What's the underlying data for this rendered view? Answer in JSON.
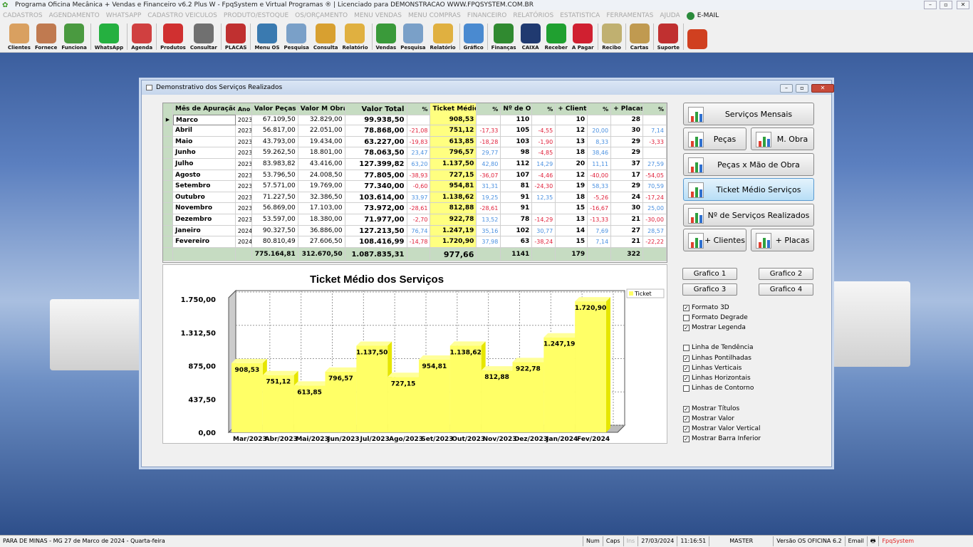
{
  "app": {
    "title": "Programa Oficina Mecânica + Vendas e Financeiro v6.2 Plus W - FpqSystem e Virtual Programas ® | Licenciado para  DEMONSTRACAO WWW.FPQSYSTEM.COM.BR"
  },
  "menu": [
    "CADASTROS",
    "AGENDAMENTO",
    "WHATSAPP",
    "CADASTRO VEICULOS",
    "PRODUTO/ESTOQUE",
    "OS/ORÇAMENTO",
    "MENU VENDAS",
    "MENU COMPRAS",
    "FINANCEIRO",
    "RELATÓRIOS",
    "ESTATISTICA",
    "FERRAMENTAS",
    "AJUDA"
  ],
  "menu_email": "E-MAIL",
  "toolbar": [
    {
      "label": "Clientes",
      "color": "#d9a060"
    },
    {
      "label": "Fornece",
      "color": "#c07a50"
    },
    {
      "label": "Funciona",
      "color": "#4a9a40"
    },
    "|",
    {
      "label": "WhatsApp",
      "color": "#25b040"
    },
    "|",
    {
      "label": "Agenda",
      "color": "#d04040"
    },
    "|",
    {
      "label": "Produtos",
      "color": "#d03030"
    },
    {
      "label": "Consultar",
      "color": "#707070"
    },
    "|",
    {
      "label": "PLACAS",
      "color": "#c03030"
    },
    "|",
    {
      "label": "Menu OS",
      "color": "#3a7ab0"
    },
    {
      "label": "Pesquisa",
      "color": "#7aa0c8"
    },
    {
      "label": "Consulta",
      "color": "#d8a030"
    },
    {
      "label": "Relatório",
      "color": "#e0b040"
    },
    "|",
    {
      "label": "Vendas",
      "color": "#3a9a3a"
    },
    {
      "label": "Pesquisa",
      "color": "#7aa0c8"
    },
    {
      "label": "Relatório",
      "color": "#e0b040"
    },
    "|",
    {
      "label": "Gráfico",
      "color": "#4a8ad0"
    },
    "|",
    {
      "label": "Finanças",
      "color": "#308a30"
    },
    {
      "label": "CAIXA",
      "color": "#203a70"
    },
    {
      "label": "Receber",
      "color": "#20a030"
    },
    {
      "label": "A Pagar",
      "color": "#d02030"
    },
    "|",
    {
      "label": "Recibo",
      "color": "#c0b070"
    },
    "|",
    {
      "label": "Cartas",
      "color": "#c09a50"
    },
    "|",
    {
      "label": "Suporte",
      "color": "#c03030"
    },
    "|",
    {
      "label": "",
      "color": "#d04020"
    }
  ],
  "dialog": {
    "title": "Demonstrativo dos Serviços Realizados"
  },
  "table": {
    "headers": [
      "Mês de Apuração",
      "Ano",
      "Valor Peças",
      "Valor M Obra",
      "Valor Total",
      "%",
      "Ticket Médio",
      "%",
      "Nº de OS",
      "%",
      "+ Clientes",
      "%",
      "+ Placas",
      "%"
    ],
    "rows": [
      [
        "Marco",
        "2023",
        "67.109,50",
        "32.829,00",
        "99.938,50",
        "",
        "908,53",
        "",
        "110",
        "",
        "10",
        "",
        "28",
        ""
      ],
      [
        "Abril",
        "2023",
        "56.817,00",
        "22.051,00",
        "78.868,00",
        "-21,08",
        "751,12",
        "-17,33",
        "105",
        "-4,55",
        "12",
        "20,00",
        "30",
        "7,14"
      ],
      [
        "Maio",
        "2023",
        "43.793,00",
        "19.434,00",
        "63.227,00",
        "-19,83",
        "613,85",
        "-18,28",
        "103",
        "-1,90",
        "13",
        "8,33",
        "29",
        "-3,33"
      ],
      [
        "Junho",
        "2023",
        "59.262,50",
        "18.801,00",
        "78.063,50",
        "23,47",
        "796,57",
        "29,77",
        "98",
        "-4,85",
        "18",
        "38,46",
        "29",
        ""
      ],
      [
        "Julho",
        "2023",
        "83.983,82",
        "43.416,00",
        "127.399,82",
        "63,20",
        "1.137,50",
        "42,80",
        "112",
        "14,29",
        "20",
        "11,11",
        "37",
        "27,59"
      ],
      [
        "Agosto",
        "2023",
        "53.796,50",
        "24.008,50",
        "77.805,00",
        "-38,93",
        "727,15",
        "-36,07",
        "107",
        "-4,46",
        "12",
        "-40,00",
        "17",
        "-54,05"
      ],
      [
        "Setembro",
        "2023",
        "57.571,00",
        "19.769,00",
        "77.340,00",
        "-0,60",
        "954,81",
        "31,31",
        "81",
        "-24,30",
        "19",
        "58,33",
        "29",
        "70,59"
      ],
      [
        "Outubro",
        "2023",
        "71.227,50",
        "32.386,50",
        "103.614,00",
        "33,97",
        "1.138,62",
        "19,25",
        "91",
        "12,35",
        "18",
        "-5,26",
        "24",
        "-17,24"
      ],
      [
        "Novembro",
        "2023",
        "56.869,00",
        "17.103,00",
        "73.972,00",
        "-28,61",
        "812,88",
        "-28,61",
        "91",
        "",
        "15",
        "-16,67",
        "30",
        "25,00"
      ],
      [
        "Dezembro",
        "2023",
        "53.597,00",
        "18.380,00",
        "71.977,00",
        "-2,70",
        "922,78",
        "13,52",
        "78",
        "-14,29",
        "13",
        "-13,33",
        "21",
        "-30,00"
      ],
      [
        "Janeiro",
        "2024",
        "90.327,50",
        "36.886,00",
        "127.213,50",
        "76,74",
        "1.247,19",
        "35,16",
        "102",
        "30,77",
        "14",
        "7,69",
        "27",
        "28,57"
      ],
      [
        "Fevereiro",
        "2024",
        "80.810,49",
        "27.606,50",
        "108.416,99",
        "-14,78",
        "1.720,90",
        "37,98",
        "63",
        "-38,24",
        "15",
        "7,14",
        "21",
        "-22,22"
      ]
    ],
    "totals": [
      "",
      "",
      "775.164,81",
      "312.670,50",
      "1.087.835,31",
      "",
      "977,66",
      "",
      "1141",
      "",
      "179",
      "",
      "322",
      ""
    ]
  },
  "chart_data": {
    "type": "bar",
    "title": "Ticket Médio dos Serviços",
    "categories": [
      "Mar/2023",
      "Abr/2023",
      "Mai/2023",
      "Jun/2023",
      "Jul/2023",
      "Ago/2023",
      "Set/2023",
      "Out/2023",
      "Nov/2023",
      "Dez/2023",
      "Jan/2024",
      "Fev/2024"
    ],
    "series": [
      {
        "name": "Ticket",
        "values": [
          908.53,
          751.12,
          613.85,
          796.57,
          1137.5,
          727.15,
          954.81,
          1138.62,
          812.88,
          922.78,
          1247.19,
          1720.9
        ]
      }
    ],
    "value_labels": [
      "908,53",
      "751,12",
      "613,85",
      "796,57",
      "1.137,50",
      "727,15",
      "954,81",
      "1.138,62",
      "812,88",
      "922,78",
      "1.247,19",
      "1.720,90"
    ],
    "yticks": [
      0,
      437.5,
      875,
      1312.5,
      1750
    ],
    "ytick_labels": [
      "0,00",
      "437,50",
      "875,00",
      "1.312,50",
      "1.750,00"
    ],
    "ylim": [
      0,
      1750
    ],
    "style": "3d",
    "grid": "dotted vertical and horizontal",
    "legend": "top-right",
    "bar_color": "#ffff66"
  },
  "right_panel": {
    "buttons": [
      "Serviços Mensais",
      "Peças",
      "M. Obra",
      "Peças x Mão de Obra",
      "Ticket Médio Serviços",
      "Nº de Serviços Realizados",
      "+ Clientes",
      "+ Placas"
    ],
    "active": "Ticket Médio Serviços",
    "graph_buttons": [
      "Grafico 1",
      "Grafico 2",
      "Grafico 3",
      "Grafico 4"
    ],
    "options": [
      {
        "label": "Formato 3D",
        "checked": true
      },
      {
        "label": "Formato Degrade",
        "checked": false
      },
      {
        "label": "Mostrar Legenda",
        "checked": true
      },
      {
        "label": "Linha de Tendência",
        "checked": false
      },
      {
        "label": "Linhas Pontilhadas",
        "checked": true
      },
      {
        "label": "Linhas Verticais",
        "checked": true
      },
      {
        "label": "Linhas Horizontais",
        "checked": true
      },
      {
        "label": "Linhas de Contorno",
        "checked": false
      },
      {
        "label": "Mostrar Títulos",
        "checked": true
      },
      {
        "label": "Mostrar Valor",
        "checked": true
      },
      {
        "label": "Mostrar Valor Vertical",
        "checked": true
      },
      {
        "label": "Mostrar Barra Inferior",
        "checked": true
      }
    ]
  },
  "status": {
    "location": "PARA DE MINAS - MG 27 de Marco de 2024 - Quarta-feira",
    "num": "Num",
    "caps": "Caps",
    "ins": "Ins",
    "date": "27/03/2024",
    "time": "11:16:51",
    "user": "MASTER",
    "version": "Versão OS OFICINA 6.2",
    "email": "Email",
    "brand": "FpqSystem"
  }
}
